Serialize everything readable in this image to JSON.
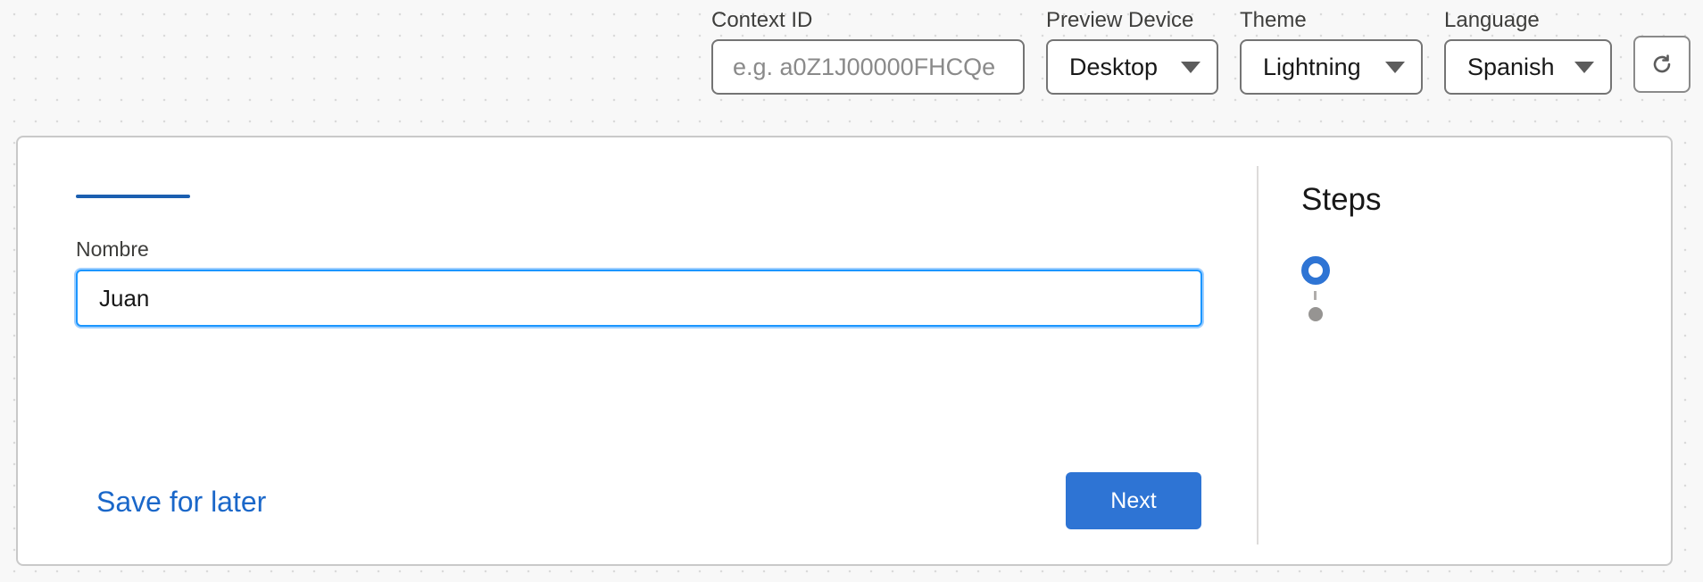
{
  "toolbar": {
    "context_id": {
      "label": "Context ID",
      "value": "",
      "placeholder": "e.g. a0Z1J00000FHCQe"
    },
    "preview_device": {
      "label": "Preview Device",
      "selected": "Desktop"
    },
    "theme": {
      "label": "Theme",
      "selected": "Lightning"
    },
    "language": {
      "label": "Language",
      "selected": "Spanish"
    },
    "refresh_icon": "refresh-icon"
  },
  "form": {
    "name_label": "Nombre",
    "name_value": "Juan",
    "save_for_later": "Save for later",
    "next_label": "Next"
  },
  "steps": {
    "title": "Steps",
    "items": [
      {
        "state": "active"
      },
      {
        "state": "inactive"
      }
    ]
  },
  "colors": {
    "accent": "#2e74d4",
    "link": "#1a67c9",
    "focus_border": "#1b96ff"
  }
}
